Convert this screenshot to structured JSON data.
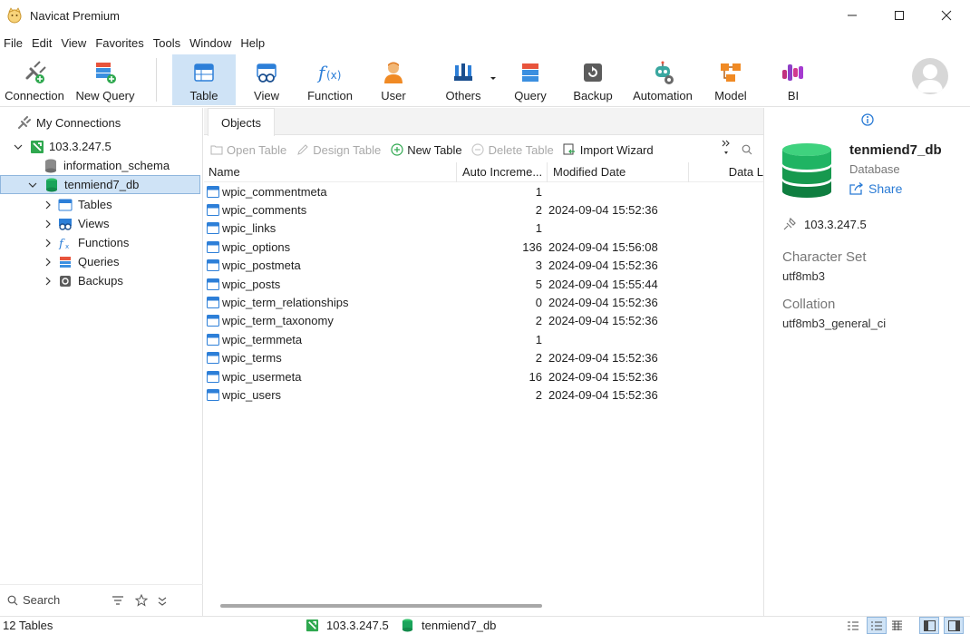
{
  "window": {
    "title": "Navicat Premium"
  },
  "menu": [
    "File",
    "Edit",
    "View",
    "Favorites",
    "Tools",
    "Window",
    "Help"
  ],
  "toolbar": {
    "connection": "Connection",
    "new_query": "New Query",
    "table": "Table",
    "view": "View",
    "function": "Function",
    "user": "User",
    "others": "Others",
    "query": "Query",
    "backup": "Backup",
    "automation": "Automation",
    "model": "Model",
    "bi": "BI"
  },
  "tree": {
    "root": "My Connections",
    "connection": "103.3.247.5",
    "db1": "information_schema",
    "db2": "tenmiend7_db",
    "children": [
      "Tables",
      "Views",
      "Functions",
      "Queries",
      "Backups"
    ]
  },
  "search": {
    "label": "Search"
  },
  "main": {
    "tab": "Objects",
    "actions": {
      "open_table": "Open Table",
      "design_table": "Design Table",
      "new_table": "New Table",
      "delete_table": "Delete Table",
      "import_wizard": "Import Wizard"
    },
    "columns": {
      "name": "Name",
      "auto": "Auto Increme...",
      "modified": "Modified Date",
      "data": "Data L"
    },
    "rows": [
      {
        "name": "wpic_commentmeta",
        "auto": "1",
        "modified": ""
      },
      {
        "name": "wpic_comments",
        "auto": "2",
        "modified": "2024-09-04 15:52:36"
      },
      {
        "name": "wpic_links",
        "auto": "1",
        "modified": ""
      },
      {
        "name": "wpic_options",
        "auto": "136",
        "modified": "2024-09-04 15:56:08"
      },
      {
        "name": "wpic_postmeta",
        "auto": "3",
        "modified": "2024-09-04 15:52:36"
      },
      {
        "name": "wpic_posts",
        "auto": "5",
        "modified": "2024-09-04 15:55:44"
      },
      {
        "name": "wpic_term_relationships",
        "auto": "0",
        "modified": "2024-09-04 15:52:36"
      },
      {
        "name": "wpic_term_taxonomy",
        "auto": "2",
        "modified": "2024-09-04 15:52:36"
      },
      {
        "name": "wpic_termmeta",
        "auto": "1",
        "modified": ""
      },
      {
        "name": "wpic_terms",
        "auto": "2",
        "modified": "2024-09-04 15:52:36"
      },
      {
        "name": "wpic_usermeta",
        "auto": "16",
        "modified": "2024-09-04 15:52:36"
      },
      {
        "name": "wpic_users",
        "auto": "2",
        "modified": "2024-09-04 15:52:36"
      }
    ]
  },
  "info": {
    "name": "tenmiend7_db",
    "type": "Database",
    "share": "Share",
    "host": "103.3.247.5",
    "charset_label": "Character Set",
    "charset": "utf8mb3",
    "collation_label": "Collation",
    "collation": "utf8mb3_general_ci"
  },
  "status": {
    "count": "12 Tables",
    "connection": "103.3.247.5",
    "database": "tenmiend7_db"
  },
  "colors": {
    "accent": "#2a7bd5",
    "selection": "#cfe3f6",
    "db_green": "#1aa35a"
  }
}
